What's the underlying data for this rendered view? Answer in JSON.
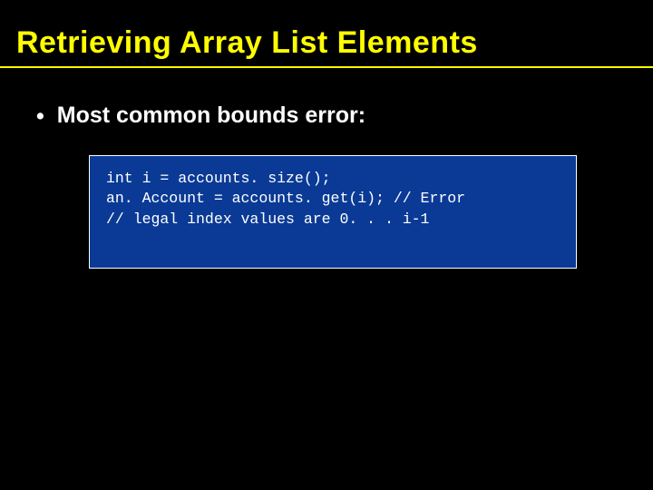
{
  "title": "Retrieving Array List Elements",
  "bullet": "Most common bounds error:",
  "code": {
    "line1": "int i = accounts. size();",
    "line2": "an. Account = accounts. get(i); // Error",
    "line3": "// legal index values are 0. . . i-1"
  }
}
